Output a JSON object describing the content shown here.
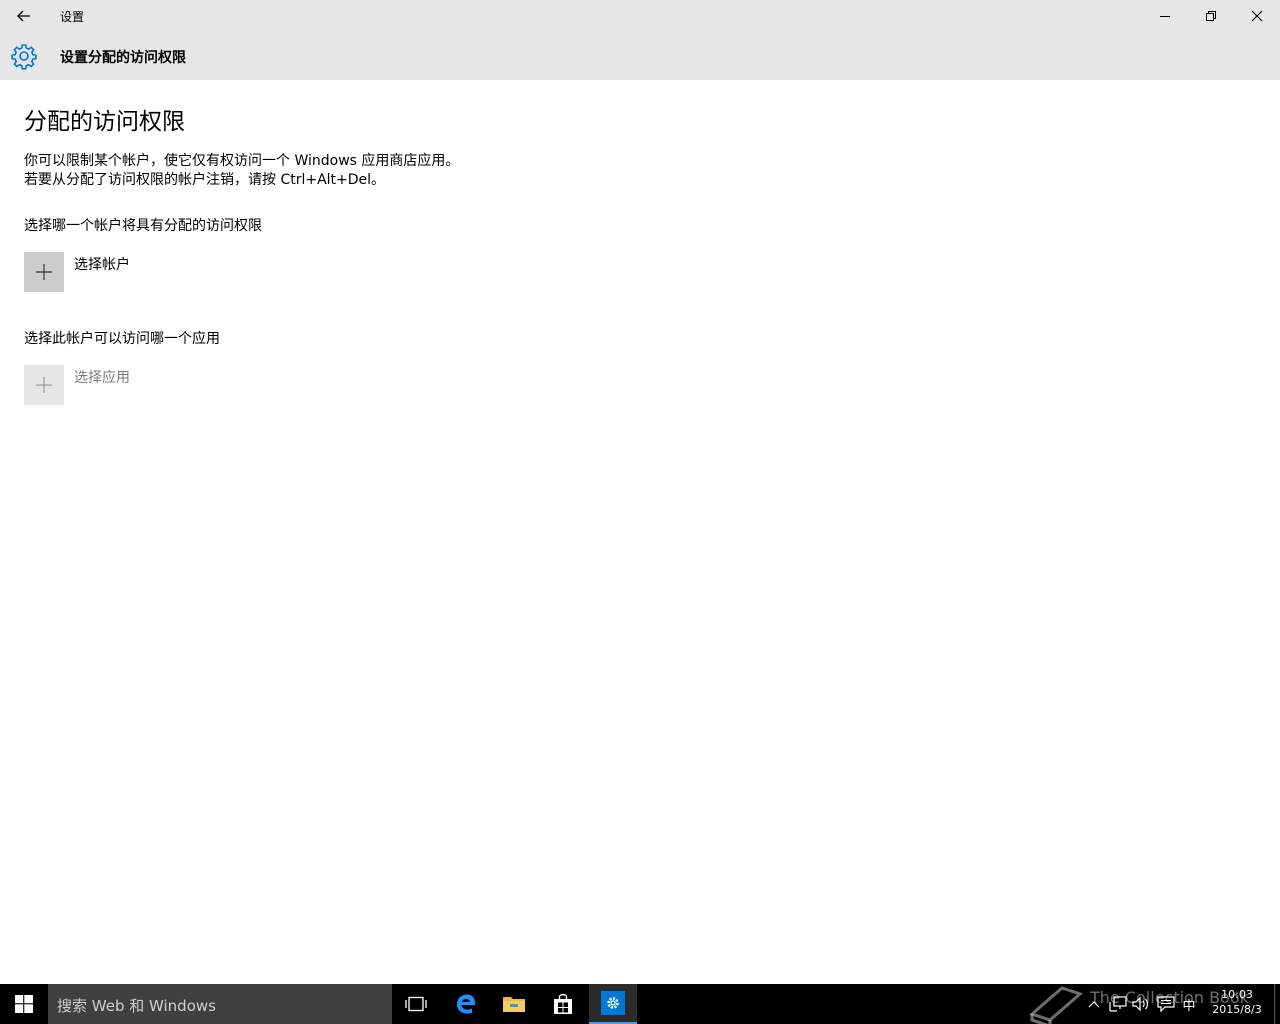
{
  "window": {
    "title": "设置"
  },
  "header": {
    "title": "设置分配的访问权限"
  },
  "main": {
    "heading": "分配的访问权限",
    "description": "你可以限制某个帐户，使它仅有权访问一个 Windows 应用商店应用。若要从分配了访问权限的帐户注销，请按 Ctrl+Alt+Del。",
    "account_section": {
      "label": "选择哪一个帐户将具有分配的访问权限",
      "button_label": "选择帐户"
    },
    "app_section": {
      "label": "选择此帐户可以访问哪一个应用",
      "button_label": "选择应用"
    }
  },
  "taskbar": {
    "search_placeholder": "搜索 Web 和 Windows",
    "watermark": "The Collection Book",
    "ime": "中",
    "clock_time": "10:03",
    "clock_date": "2015/8/3"
  },
  "colors": {
    "accent": "#0078d7",
    "titlebar": "#e6e6e6",
    "plus_active": "#cccccc",
    "plus_disabled": "#e6e6e6",
    "disabled_text": "#7a7a7a"
  }
}
